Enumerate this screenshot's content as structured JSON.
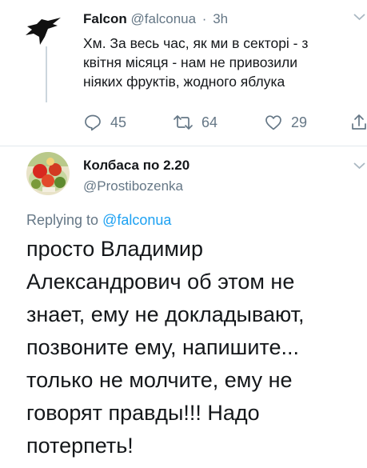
{
  "parent_tweet": {
    "avatar": "crow-avatar",
    "name": "Falcon",
    "handle": "@falconua",
    "separator": "·",
    "time": "3h",
    "text_lines": [
      "Хм. За весь час, як ми в секторі - з",
      "квітня місяця - нам не привозили",
      "ніяких фруктів, жодного яблука"
    ],
    "actions": {
      "reply": {
        "icon": "reply-icon",
        "count": "45"
      },
      "retweet": {
        "icon": "retweet-icon",
        "count": "64"
      },
      "like": {
        "icon": "heart-icon",
        "count": "29"
      },
      "share": {
        "icon": "share-icon"
      }
    }
  },
  "reply_tweet": {
    "avatar": "profile-avatar",
    "name": "Колбаса по 2.20",
    "handle": "@Prostibozenka",
    "replying_prefix": "Replying to",
    "replying_to": "@falconua",
    "text_lines": [
      "просто Владимир",
      "Александрович об этом не",
      "знает, ему не докладывают,",
      "позвоните ему, напишите...",
      "только не молчите, ему не",
      "говорят правды!!! Надо",
      "потерпеть!"
    ]
  },
  "colors": {
    "text": "#14171a",
    "secondary": "#657786",
    "link": "#1da1f2",
    "divider": "#e1e8ed",
    "thread_line": "#ccd6dd"
  }
}
